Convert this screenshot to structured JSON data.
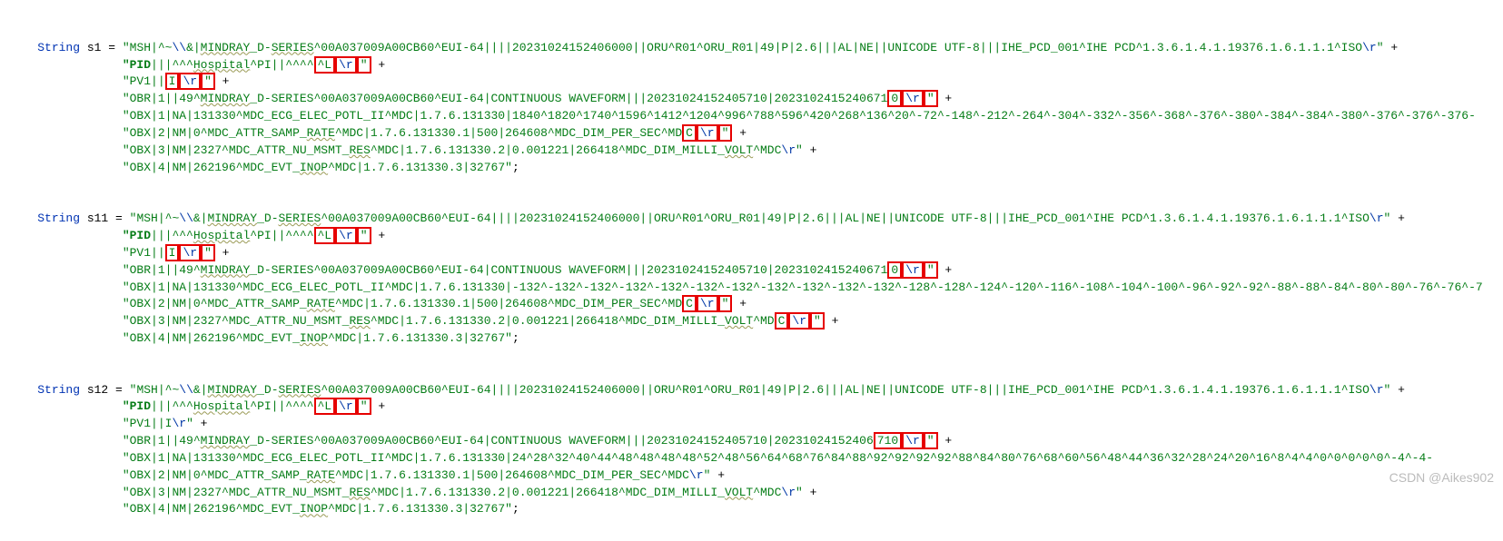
{
  "vars": {
    "s1": {
      "type": "String",
      "name": "s1",
      "lines": [
        [
          {
            "t": "kw",
            "v": "String "
          },
          {
            "t": "var-decl",
            "v": "s1 "
          },
          {
            "t": "op",
            "v": "= "
          },
          {
            "t": "str",
            "v": "\"MSH|^~"
          },
          {
            "t": "esc",
            "v": "\\\\"
          },
          {
            "t": "str",
            "v": "&|"
          },
          {
            "t": "str u-wavy",
            "v": "MINDRAY"
          },
          {
            "t": "str",
            "v": "_D-"
          },
          {
            "t": "str u-wavy",
            "v": "SERIES"
          },
          {
            "t": "str",
            "v": "^00A037009A00CB60^EUI-64||||20231024152406000||ORU^R01^ORU_R01|49|P|2.6|||AL|NE||UNICODE UTF-8|||IHE_PCD_001^IHE PCD^1.3.6.1.4.1.19376.1.6.1.1.1^ISO"
          },
          {
            "t": "esc",
            "v": "\\r"
          },
          {
            "t": "str",
            "v": "\""
          },
          {
            "t": "op",
            "v": " +"
          }
        ],
        [
          {
            "t": "pid",
            "v": "        \"PID"
          },
          {
            "t": "str",
            "v": "|||^^^"
          },
          {
            "t": "str u-wavy",
            "v": "Hospital"
          },
          {
            "t": "str",
            "v": "^PI||^^^^"
          },
          {
            "t": "str redbox",
            "v": "^L"
          },
          {
            "t": "esc redbox",
            "v": "\\r"
          },
          {
            "t": "str redbox",
            "v": "\""
          },
          {
            "t": "op",
            "v": " +"
          }
        ],
        [
          {
            "t": "str",
            "v": "        \"PV1||"
          },
          {
            "t": "str redbox",
            "v": "I"
          },
          {
            "t": "esc redbox",
            "v": "\\r"
          },
          {
            "t": "str redbox",
            "v": "\""
          },
          {
            "t": "op",
            "v": " +"
          }
        ],
        [
          {
            "t": "str",
            "v": "        \"OBR|1||49^"
          },
          {
            "t": "str u-wavy",
            "v": "MINDRAY"
          },
          {
            "t": "str",
            "v": "_D-SERIES^00A037009A00CB60^EUI-64|CONTINUOUS WAVEFORM|||20231024152405710|2023102415240671"
          },
          {
            "t": "str redbox",
            "v": "0"
          },
          {
            "t": "esc redbox",
            "v": "\\r"
          },
          {
            "t": "str redbox",
            "v": "\""
          },
          {
            "t": "op",
            "v": " +"
          }
        ],
        [
          {
            "t": "str",
            "v": "        \"OBX|1|NA|131330^MDC_ECG_ELEC_POTL_II^MDC|1.7.6.131330|1840^1820^1740^1596^1412^1204^996^788^596^420^268^136^20^-72^-148^-212^-264^-304^-332^-356^-368^-376^-380^-384^-384^-380^-376^-376^-376-"
          }
        ],
        [
          {
            "t": "str",
            "v": "        \"OBX|2|NM|0^MDC_ATTR_SAMP_"
          },
          {
            "t": "str u-wavy",
            "v": "RATE"
          },
          {
            "t": "str",
            "v": "^MDC|1.7.6.131330.1|500|264608^MDC_DIM_PER_SEC^MD"
          },
          {
            "t": "str redbox",
            "v": "C"
          },
          {
            "t": "esc redbox",
            "v": "\\r"
          },
          {
            "t": "str redbox",
            "v": "\""
          },
          {
            "t": "op",
            "v": " +"
          }
        ],
        [
          {
            "t": "str",
            "v": "        \"OBX|3|NM|2327^MDC_ATTR_NU_MSMT_"
          },
          {
            "t": "str u-wavy",
            "v": "RES"
          },
          {
            "t": "str",
            "v": "^MDC|1.7.6.131330.2|0.001221|266418^MDC_DIM_MILLI_"
          },
          {
            "t": "str u-wavy",
            "v": "VOLT"
          },
          {
            "t": "str",
            "v": "^MDC"
          },
          {
            "t": "esc",
            "v": "\\r"
          },
          {
            "t": "str",
            "v": "\""
          },
          {
            "t": "op",
            "v": " +"
          }
        ],
        [
          {
            "t": "str",
            "v": "        \"OBX|4|NM|262196^MDC_EVT_"
          },
          {
            "t": "str u-wavy",
            "v": "INOP"
          },
          {
            "t": "str",
            "v": "^MDC|1.7.6.131330.3|32767\""
          },
          {
            "t": "op",
            "v": ";"
          }
        ]
      ]
    },
    "s11": {
      "type": "String",
      "name": "s11",
      "lines": [
        [
          {
            "t": "kw",
            "v": "String "
          },
          {
            "t": "var-decl",
            "v": "s11 "
          },
          {
            "t": "op",
            "v": "= "
          },
          {
            "t": "str",
            "v": "\"MSH|^~"
          },
          {
            "t": "esc",
            "v": "\\\\"
          },
          {
            "t": "str",
            "v": "&|"
          },
          {
            "t": "str u-wavy",
            "v": "MINDRAY"
          },
          {
            "t": "str",
            "v": "_D-"
          },
          {
            "t": "str u-wavy",
            "v": "SERIES"
          },
          {
            "t": "str",
            "v": "^00A037009A00CB60^EUI-64||||20231024152406000||ORU^R01^ORU_R01|49|P|2.6|||AL|NE||UNICODE UTF-8|||IHE_PCD_001^IHE PCD^1.3.6.1.4.1.19376.1.6.1.1.1^ISO"
          },
          {
            "t": "esc",
            "v": "\\r"
          },
          {
            "t": "str",
            "v": "\""
          },
          {
            "t": "op",
            "v": " +"
          }
        ],
        [
          {
            "t": "pid",
            "v": "        \"PID"
          },
          {
            "t": "str",
            "v": "|||^^^"
          },
          {
            "t": "str u-wavy",
            "v": "Hospital"
          },
          {
            "t": "str",
            "v": "^PI||^^^^"
          },
          {
            "t": "str redbox",
            "v": "^L"
          },
          {
            "t": "esc redbox",
            "v": "\\r"
          },
          {
            "t": "str redbox",
            "v": "\""
          },
          {
            "t": "op",
            "v": " +"
          }
        ],
        [
          {
            "t": "str",
            "v": "        \"PV1||"
          },
          {
            "t": "str redbox",
            "v": "I"
          },
          {
            "t": "esc redbox",
            "v": "\\r"
          },
          {
            "t": "str redbox",
            "v": "\""
          },
          {
            "t": "op",
            "v": " +"
          }
        ],
        [
          {
            "t": "str",
            "v": "        \"OBR|1||49^"
          },
          {
            "t": "str u-wavy",
            "v": "MINDRAY"
          },
          {
            "t": "str",
            "v": "_D-SERIES^00A037009A00CB60^EUI-64|CONTINUOUS WAVEFORM|||20231024152405710|2023102415240671"
          },
          {
            "t": "str redbox",
            "v": "0"
          },
          {
            "t": "esc redbox",
            "v": "\\r"
          },
          {
            "t": "str redbox",
            "v": "\""
          },
          {
            "t": "op",
            "v": " +"
          }
        ],
        [
          {
            "t": "str",
            "v": "        \"OBX|1|NA|131330^MDC_ECG_ELEC_POTL_II^MDC|1.7.6.131330|-132^-132^-132^-132^-132^-132^-132^-132^-132^-132^-132^-128^-128^-124^-120^-116^-108^-104^-100^-96^-92^-92^-88^-88^-84^-80^-80^-76^-76^-7"
          }
        ],
        [
          {
            "t": "str",
            "v": "        \"OBX|2|NM|0^MDC_ATTR_SAMP_"
          },
          {
            "t": "str u-wavy",
            "v": "RATE"
          },
          {
            "t": "str",
            "v": "^MDC|1.7.6.131330.1|500|264608^MDC_DIM_PER_SEC^MD"
          },
          {
            "t": "str redbox",
            "v": "C"
          },
          {
            "t": "esc redbox",
            "v": "\\r"
          },
          {
            "t": "str redbox",
            "v": "\""
          },
          {
            "t": "op",
            "v": " +"
          }
        ],
        [
          {
            "t": "str",
            "v": "        \"OBX|3|NM|2327^MDC_ATTR_NU_MSMT_"
          },
          {
            "t": "str u-wavy",
            "v": "RES"
          },
          {
            "t": "str",
            "v": "^MDC|1.7.6.131330.2|0.001221|266418^MDC_DIM_MILLI_"
          },
          {
            "t": "str u-wavy",
            "v": "VOLT"
          },
          {
            "t": "str",
            "v": "^MD"
          },
          {
            "t": "str redbox",
            "v": "C"
          },
          {
            "t": "esc redbox",
            "v": "\\r"
          },
          {
            "t": "str redbox",
            "v": "\""
          },
          {
            "t": "op",
            "v": " +"
          }
        ],
        [
          {
            "t": "str",
            "v": "        \"OBX|4|NM|262196^MDC_EVT_"
          },
          {
            "t": "str u-wavy",
            "v": "INOP"
          },
          {
            "t": "str",
            "v": "^MDC|1.7.6.131330.3|32767\""
          },
          {
            "t": "op",
            "v": ";"
          }
        ]
      ]
    },
    "s12": {
      "type": "String",
      "name": "s12",
      "lines": [
        [
          {
            "t": "kw",
            "v": "String "
          },
          {
            "t": "var-decl",
            "v": "s12 "
          },
          {
            "t": "op",
            "v": "= "
          },
          {
            "t": "str",
            "v": "\"MSH|^~"
          },
          {
            "t": "esc",
            "v": "\\\\"
          },
          {
            "t": "str",
            "v": "&|"
          },
          {
            "t": "str u-wavy",
            "v": "MINDRAY"
          },
          {
            "t": "str",
            "v": "_D-"
          },
          {
            "t": "str u-wavy",
            "v": "SERIES"
          },
          {
            "t": "str",
            "v": "^00A037009A00CB60^EUI-64||||20231024152406000||ORU^R01^ORU_R01|49|P|2.6|||AL|NE||UNICODE UTF-8|||IHE_PCD_001^IHE PCD^1.3.6.1.4.1.19376.1.6.1.1.1^ISO"
          },
          {
            "t": "esc",
            "v": "\\r"
          },
          {
            "t": "str",
            "v": "\""
          },
          {
            "t": "op",
            "v": " +"
          }
        ],
        [
          {
            "t": "pid",
            "v": "        \"PID"
          },
          {
            "t": "str",
            "v": "|||^^^"
          },
          {
            "t": "str u-wavy",
            "v": "Hospital"
          },
          {
            "t": "str",
            "v": "^PI||^^^^"
          },
          {
            "t": "str redbox",
            "v": "^L"
          },
          {
            "t": "esc redbox",
            "v": "\\r"
          },
          {
            "t": "str redbox",
            "v": "\""
          },
          {
            "t": "op",
            "v": " +"
          }
        ],
        [
          {
            "t": "str",
            "v": "        \"PV1||I"
          },
          {
            "t": "esc",
            "v": "\\r"
          },
          {
            "t": "str",
            "v": "\""
          },
          {
            "t": "op",
            "v": " +"
          }
        ],
        [
          {
            "t": "str",
            "v": "        \"OBR|1||49^"
          },
          {
            "t": "str u-wavy",
            "v": "MINDRAY"
          },
          {
            "t": "str",
            "v": "_D-SERIES^00A037009A00CB60^EUI-64|CONTINUOUS WAVEFORM|||20231024152405710|20231024152406"
          },
          {
            "t": "str redbox",
            "v": "710"
          },
          {
            "t": "esc redbox",
            "v": "\\r"
          },
          {
            "t": "str redbox",
            "v": "\""
          },
          {
            "t": "op",
            "v": " +"
          }
        ],
        [
          {
            "t": "str",
            "v": "        \"OBX|1|NA|131330^MDC_ECG_ELEC_POTL_II^MDC|1.7.6.131330|24^28^32^40^44^48^48^48^48^52^48^56^64^68^76^84^88^92^92^92^92^88^84^80^76^68^60^56^48^44^36^32^28^24^20^16^8^4^4^0^0^0^0^0^-4^-4-"
          }
        ],
        [
          {
            "t": "str",
            "v": "        \"OBX|2|NM|0^MDC_ATTR_SAMP_"
          },
          {
            "t": "str u-wavy",
            "v": "RATE"
          },
          {
            "t": "str",
            "v": "^MDC|1.7.6.131330.1|500|264608^MDC_DIM_PER_SEC^MDC"
          },
          {
            "t": "esc",
            "v": "\\r"
          },
          {
            "t": "str",
            "v": "\""
          },
          {
            "t": "op",
            "v": " +"
          }
        ],
        [
          {
            "t": "str",
            "v": "        \"OBX|3|NM|2327^MDC_ATTR_NU_MSMT_"
          },
          {
            "t": "str u-wavy",
            "v": "RES"
          },
          {
            "t": "str",
            "v": "^MDC|1.7.6.131330.2|0.001221|266418^MDC_DIM_MILLI_"
          },
          {
            "t": "str u-wavy",
            "v": "VOLT"
          },
          {
            "t": "str",
            "v": "^MDC"
          },
          {
            "t": "esc",
            "v": "\\r"
          },
          {
            "t": "str",
            "v": "\""
          },
          {
            "t": "op",
            "v": " +"
          }
        ],
        [
          {
            "t": "str",
            "v": "        \"OBX|4|NM|262196^MDC_EVT_"
          },
          {
            "t": "str u-wavy",
            "v": "INOP"
          },
          {
            "t": "str",
            "v": "^MDC|1.7.6.131330.3|32767\""
          },
          {
            "t": "op",
            "v": ";"
          }
        ]
      ]
    }
  },
  "watermark": "CSDN @Aikes902"
}
